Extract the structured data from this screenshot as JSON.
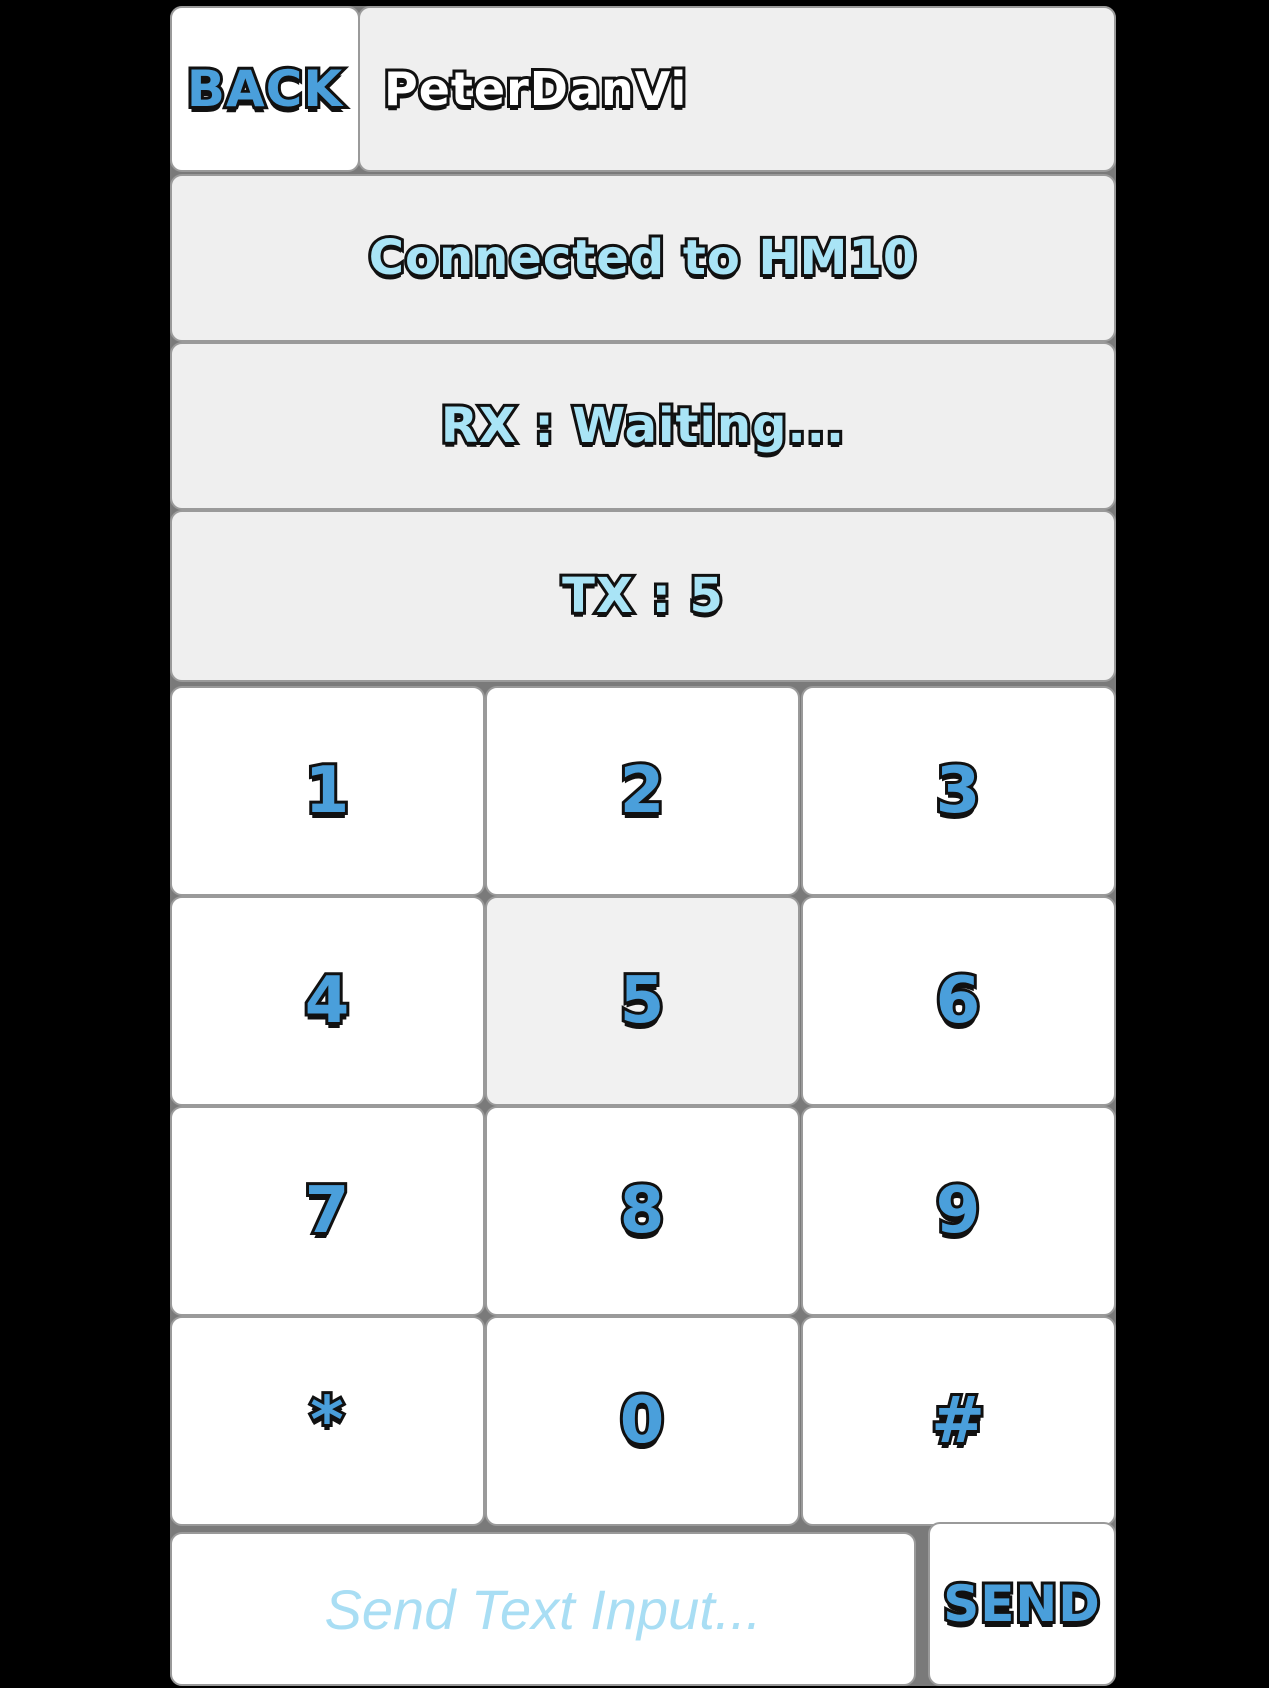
{
  "header": {
    "back_label": "BACK",
    "device_name": "PeterDanVi"
  },
  "status": {
    "connection": "Connected to HM10",
    "rx": "RX : Waiting...",
    "tx": "TX : 5"
  },
  "keypad": {
    "keys": [
      "1",
      "2",
      "3",
      "4",
      "5",
      "6",
      "7",
      "8",
      "9",
      "*",
      "0",
      "#"
    ]
  },
  "input": {
    "placeholder": "Send Text Input...",
    "value": ""
  },
  "send_label": "SEND",
  "colors": {
    "key_text": "#4a9fdb",
    "status_text": "#a9e4f6",
    "panel_grey": "#efefef",
    "key_white": "#ffffff"
  }
}
